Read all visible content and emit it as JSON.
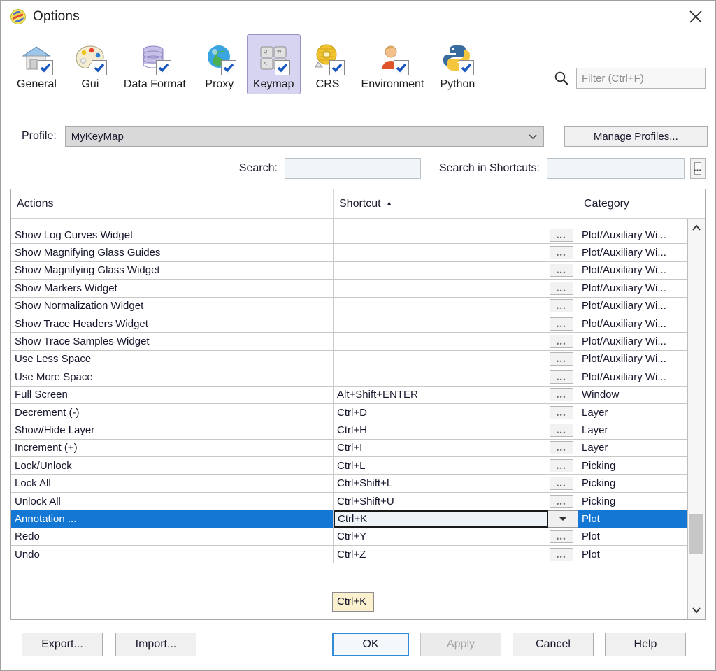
{
  "window": {
    "title": "Options",
    "app_icon": "options-ball-icon",
    "close_label": "close-icon"
  },
  "toolbar": {
    "items": [
      {
        "label": "General",
        "icon": "house-icon"
      },
      {
        "label": "Gui",
        "icon": "palette-icon"
      },
      {
        "label": "Data Format",
        "icon": "database-icon"
      },
      {
        "label": "Proxy",
        "icon": "globe-icon"
      },
      {
        "label": "Keymap",
        "icon": "keyboard-icon",
        "selected": true
      },
      {
        "label": "CRS",
        "icon": "measuring-tape-icon"
      },
      {
        "label": "Environment",
        "icon": "person-icon"
      },
      {
        "label": "Python",
        "icon": "python-icon"
      }
    ],
    "filter": {
      "placeholder": "Filter (Ctrl+F)",
      "value": "",
      "icon": "search-icon"
    }
  },
  "profile": {
    "label": "Profile:",
    "value": "MyKeyMap",
    "manage_button": "Manage Profiles..."
  },
  "search": {
    "label": "Search:",
    "value": "",
    "shortcuts_label": "Search in Shortcuts:",
    "shortcuts_value": "",
    "capture_button_icon": "keyboard-capture-icon"
  },
  "table": {
    "columns": [
      "Actions",
      "Shortcut",
      "Category"
    ],
    "sort_column": "Shortcut",
    "sort_indicator": "▲",
    "ellipsis_label": "...",
    "rows": [
      {
        "action": "Show Log Curves Widget",
        "shortcut": "",
        "category": "Plot/Auxiliary Wi..."
      },
      {
        "action": "Show Magnifying Glass Guides",
        "shortcut": "",
        "category": "Plot/Auxiliary Wi..."
      },
      {
        "action": "Show Magnifying Glass Widget",
        "shortcut": "",
        "category": "Plot/Auxiliary Wi..."
      },
      {
        "action": "Show Markers Widget",
        "shortcut": "",
        "category": "Plot/Auxiliary Wi..."
      },
      {
        "action": "Show Normalization Widget",
        "shortcut": "",
        "category": "Plot/Auxiliary Wi..."
      },
      {
        "action": "Show Trace Headers Widget",
        "shortcut": "",
        "category": "Plot/Auxiliary Wi..."
      },
      {
        "action": "Show Trace Samples Widget",
        "shortcut": "",
        "category": "Plot/Auxiliary Wi..."
      },
      {
        "action": "Use Less Space",
        "shortcut": "",
        "category": "Plot/Auxiliary Wi..."
      },
      {
        "action": "Use More Space",
        "shortcut": "",
        "category": "Plot/Auxiliary Wi..."
      },
      {
        "action": "Full Screen",
        "shortcut": "Alt+Shift+ENTER",
        "category": "Window"
      },
      {
        "action": "Decrement (-)",
        "shortcut": "Ctrl+D",
        "category": "Layer"
      },
      {
        "action": "Show/Hide Layer",
        "shortcut": "Ctrl+H",
        "category": "Layer"
      },
      {
        "action": "Increment (+)",
        "shortcut": "Ctrl+I",
        "category": "Layer"
      },
      {
        "action": "Lock/Unlock",
        "shortcut": "Ctrl+L",
        "category": "Picking"
      },
      {
        "action": "Lock All",
        "shortcut": "Ctrl+Shift+L",
        "category": "Picking"
      },
      {
        "action": "Unlock All",
        "shortcut": "Ctrl+Shift+U",
        "category": "Picking"
      },
      {
        "action": "Annotation ...",
        "shortcut": "Ctrl+K",
        "category": "Plot",
        "selected": true,
        "editing": true
      },
      {
        "action": "Redo",
        "shortcut": "Ctrl+Y",
        "category": "Plot"
      },
      {
        "action": "Undo",
        "shortcut": "Ctrl+Z",
        "category": "Plot"
      }
    ],
    "selection_color": "#1477d4"
  },
  "tooltip": {
    "text": "Ctrl+K"
  },
  "footer": {
    "export": "Export...",
    "import": "Import...",
    "ok": "OK",
    "apply": "Apply",
    "apply_disabled": true,
    "cancel": "Cancel",
    "help": "Help"
  }
}
